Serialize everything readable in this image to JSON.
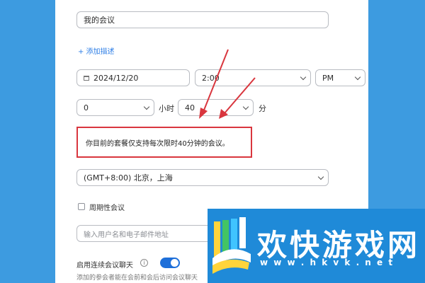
{
  "meeting": {
    "topic": "我的会议",
    "add_description": "+ 添加描述",
    "date": "2024/12/20",
    "time": "2:00",
    "ampm": "PM",
    "duration_hours": "0",
    "hours_unit": "小时",
    "duration_minutes": "40",
    "minutes_unit": "分",
    "plan_notice": "你目前的套餐仅支持每次限时40分钟的会议。",
    "timezone": "(GMT+8:00) 北京，上海",
    "recurring_label": "周期性会议",
    "invitee_placeholder": "输入用户名和电子邮件地址",
    "continuous_chat_label": "启用连续会议聊天",
    "continuous_chat_desc": "添加的参会者能在会前和会后访问会议聊天"
  },
  "watermark": {
    "title": "欢快游戏网",
    "url": "w w w . h k v k . n e t"
  },
  "colors": {
    "accent": "#2d7ee6",
    "annotation": "#d9363e",
    "background": "#3d9be0"
  }
}
